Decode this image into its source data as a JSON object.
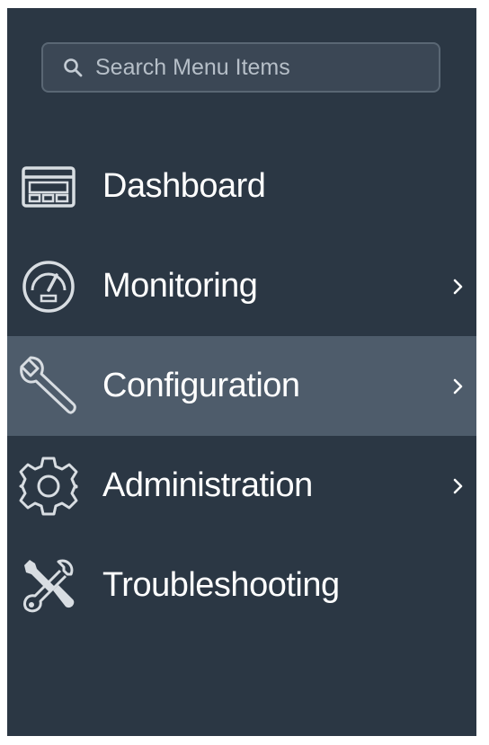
{
  "search": {
    "placeholder": "Search Menu Items",
    "icon": "search-icon"
  },
  "menu": {
    "items": [
      {
        "label": "Dashboard",
        "icon": "dashboard-icon",
        "has_submenu": false,
        "active": false
      },
      {
        "label": "Monitoring",
        "icon": "gauge-icon",
        "has_submenu": true,
        "active": false
      },
      {
        "label": "Configuration",
        "icon": "wrench-icon",
        "has_submenu": true,
        "active": true
      },
      {
        "label": "Administration",
        "icon": "gear-icon",
        "has_submenu": true,
        "active": false
      },
      {
        "label": "Troubleshooting",
        "icon": "tools-icon",
        "has_submenu": false,
        "active": false
      }
    ]
  },
  "colors": {
    "sidebar_bg": "#2b3744",
    "active_bg": "#4e5c6b",
    "search_bg": "#3b4755",
    "search_border": "#5a6774",
    "text": "#ffffff",
    "icon_stroke": "#d8dde2"
  }
}
